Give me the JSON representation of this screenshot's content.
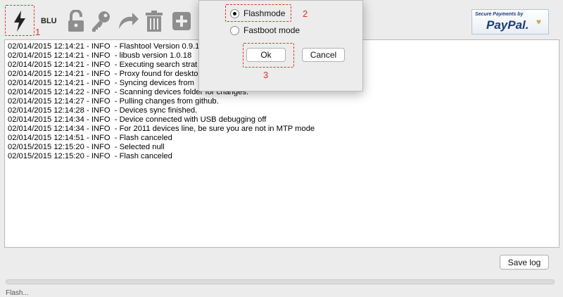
{
  "toolbar": {
    "device_label": "BLU",
    "icons": [
      "flash-icon",
      "unlock-icon",
      "key-icon",
      "redo-arrow-icon",
      "trash-icon",
      "add-icon"
    ]
  },
  "annotations": {
    "a1": "1",
    "a2": "2",
    "a3": "3"
  },
  "paypal": {
    "secure_text": "Secure Payments by",
    "brand_text": "PayPal.",
    "heart": "♥"
  },
  "log_lines": [
    "02/014/2015 12:14:21 - INFO  - Flashtool Version 0.9.1",
    "02/014/2015 12:14:21 - INFO  - libusb version 1.0.18",
    "02/014/2015 12:14:21 - INFO  - Executing search strat",
    "02/014/2015 12:14:21 - INFO  - Proxy found for deskto",
    "02/014/2015 12:14:21 - INFO  - Syncing devices from",
    "02/014/2015 12:14:22 - INFO  - Scanning devices folder for changes.",
    "02/014/2015 12:14:27 - INFO  - Pulling changes from github.",
    "02/014/2015 12:14:28 - INFO  - Devices sync finished.",
    "02/014/2015 12:14:34 - INFO  - Device connected with USB debugging off",
    "02/014/2015 12:14:34 - INFO  - For 2011 devices line, be sure you are not in MTP mode",
    "02/014/2015 12:14:51 - INFO  - Flash canceled",
    "02/015/2015 12:15:20 - INFO  - Selected null",
    "02/015/2015 12:15:20 - INFO  - Flash canceled"
  ],
  "buttons": {
    "save_log": "Save log",
    "ok": "Ok",
    "cancel": "Cancel"
  },
  "dialog": {
    "options": [
      {
        "label": "Flashmode",
        "selected": true
      },
      {
        "label": "Fastboot mode",
        "selected": false
      }
    ]
  },
  "status": {
    "text": "Flash..."
  },
  "colors": {
    "annotation": "#e0302a",
    "background": "#ececec"
  }
}
